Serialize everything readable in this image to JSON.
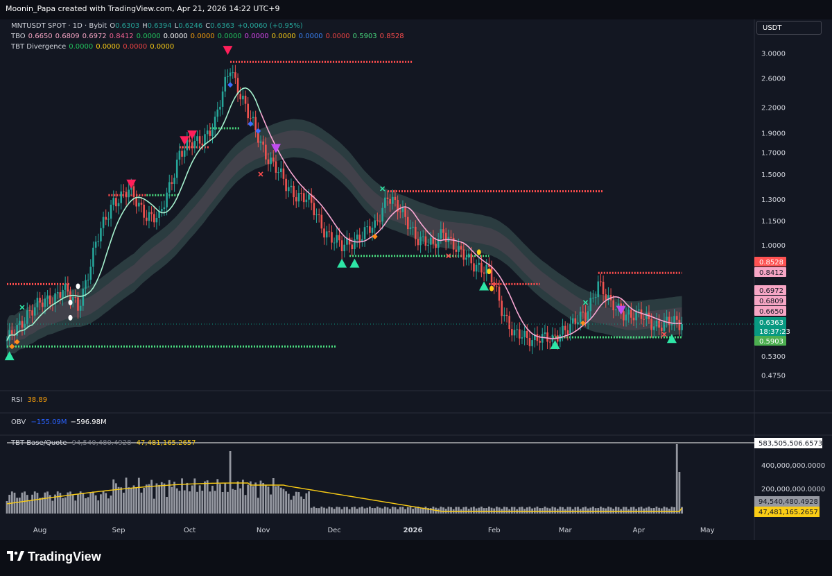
{
  "header": {
    "watermark": "Moonin_Papa created with TradingView.com, Apr 21, 2026 14:22 UTC+9",
    "currency_button": "USDT"
  },
  "legend": {
    "symbol_line": [
      {
        "text": "MNTUSDT SPOT · 1D · Bybit",
        "color": "#d1d4dc"
      },
      {
        "text": "O",
        "color": "#d1d4dc"
      },
      {
        "text": "0.6303",
        "color": "#26a69a"
      },
      {
        "text": "H",
        "color": "#d1d4dc"
      },
      {
        "text": "0.6394",
        "color": "#26a69a"
      },
      {
        "text": "L",
        "color": "#d1d4dc"
      },
      {
        "text": "0.6246",
        "color": "#26a69a"
      },
      {
        "text": "C",
        "color": "#d1d4dc"
      },
      {
        "text": "0.6363",
        "color": "#26a69a"
      },
      {
        "text": "+0.0060 (+0.95%)",
        "color": "#26a69a"
      }
    ],
    "tbo_line": [
      {
        "text": "TBO",
        "color": "#d1d4dc"
      },
      {
        "text": "0.6650",
        "color": "#f7a6c5"
      },
      {
        "text": "0.6809",
        "color": "#f7a6c5"
      },
      {
        "text": "0.6972",
        "color": "#f7a6c5"
      },
      {
        "text": "0.8412",
        "color": "#f06292"
      },
      {
        "text": "0.0000",
        "color": "#22c55e"
      },
      {
        "text": "0.0000",
        "color": "#ffffff"
      },
      {
        "text": "0.0000",
        "color": "#f59e0b"
      },
      {
        "text": "0.0000",
        "color": "#22c55e"
      },
      {
        "text": "0.0000",
        "color": "#d946ef"
      },
      {
        "text": "0.0000",
        "color": "#facc15"
      },
      {
        "text": "0.0000",
        "color": "#3b82f6"
      },
      {
        "text": "0.0000",
        "color": "#ef4444"
      },
      {
        "text": "0.5903",
        "color": "#4ade80"
      },
      {
        "text": "0.8528",
        "color": "#ff4d4d"
      }
    ],
    "divergence_line": [
      {
        "text": "TBT Divergence",
        "color": "#d1d4dc"
      },
      {
        "text": "0.0000",
        "color": "#22c55e"
      },
      {
        "text": "0.0000",
        "color": "#facc15"
      },
      {
        "text": "0.0000",
        "color": "#ef4444"
      },
      {
        "text": "0.0000",
        "color": "#facc15"
      }
    ]
  },
  "panes": {
    "rsi": {
      "name": "RSI",
      "value": "38.89",
      "value_color": "#f59e0b"
    },
    "obv": {
      "name": "OBV",
      "value1": "−155.09M",
      "value1_color": "#2962ff",
      "value2": "−596.98M",
      "value2_color": "#ffffff"
    },
    "volume": {
      "name": "TBT Base/Quote",
      "value1": "94,540,480.4928",
      "value2": "47,481,165.2657",
      "value2_color": "#facc15"
    }
  },
  "footer": {
    "brand": "TradingView"
  },
  "chart_data": {
    "type": "candlestick",
    "scale": "log",
    "price_axis_ticks": [
      "3.0000",
      "2.6000",
      "2.2000",
      "1.9000",
      "1.7000",
      "1.5000",
      "1.3000",
      "1.1500",
      "1.0000",
      "0.5300",
      "0.4750"
    ],
    "time_axis_ticks": [
      "Aug",
      "Sep",
      "Oct",
      "Nov",
      "Dec",
      "2026",
      "Feb",
      "Mar",
      "Apr",
      "May"
    ],
    "price_labels": [
      {
        "text": "0.8528",
        "bg": "#ff5252",
        "fg": "#ffffff",
        "value": 0.8528
      },
      {
        "text": "0.8412",
        "bg": "#f7a6c5",
        "fg": "#131722",
        "value": 0.8412
      },
      {
        "text": "0.6972",
        "bg": "#f7a6c5",
        "fg": "#131722",
        "value": 0.6972
      },
      {
        "text": "0.6809",
        "bg": "#f7a6c5",
        "fg": "#131722",
        "value": 0.6809
      },
      {
        "text": "0.6650",
        "bg": "#f7a6c5",
        "fg": "#131722",
        "value": 0.665
      },
      {
        "text": "0.6363",
        "bg": "#089981",
        "fg": "#ffffff",
        "value": 0.6363
      },
      {
        "text": "18:37:23",
        "bg": "#089981",
        "fg": "#ffffff",
        "value": 0.6363
      },
      {
        "text": "0.5903",
        "bg": "#4caf50",
        "fg": "#ffffff",
        "value": 0.5903
      }
    ],
    "close_anchors": [
      [
        0,
        0.57
      ],
      [
        8,
        0.68
      ],
      [
        15,
        0.72
      ],
      [
        22,
        0.78
      ],
      [
        28,
        0.7
      ],
      [
        35,
        1.0
      ],
      [
        42,
        1.3
      ],
      [
        48,
        1.35
      ],
      [
        55,
        1.2
      ],
      [
        60,
        1.15
      ],
      [
        68,
        1.7
      ],
      [
        75,
        1.8
      ],
      [
        82,
        2.0
      ],
      [
        88,
        2.8
      ],
      [
        95,
        2.1
      ],
      [
        102,
        1.7
      ],
      [
        110,
        1.4
      ],
      [
        118,
        1.3
      ],
      [
        125,
        1.1
      ],
      [
        132,
        0.98
      ],
      [
        138,
        1.05
      ],
      [
        145,
        1.1
      ],
      [
        150,
        1.35
      ],
      [
        155,
        1.2
      ],
      [
        162,
        1.05
      ],
      [
        168,
        0.98
      ],
      [
        172,
        1.1
      ],
      [
        178,
        0.95
      ],
      [
        185,
        0.9
      ],
      [
        190,
        0.85
      ],
      [
        195,
        0.7
      ],
      [
        200,
        0.6
      ],
      [
        205,
        0.58
      ],
      [
        210,
        0.6
      ],
      [
        215,
        0.57
      ],
      [
        220,
        0.63
      ],
      [
        228,
        0.66
      ],
      [
        233,
        0.82
      ],
      [
        238,
        0.7
      ],
      [
        245,
        0.68
      ],
      [
        255,
        0.64
      ],
      [
        266,
        0.6363
      ]
    ],
    "volume_ticks": [
      "583,505,506.6573",
      "400,000,000.0000",
      "200,000,000.0000"
    ],
    "volume_last": [
      {
        "text": "94,540,480.4928",
        "bg": "#9598a1"
      },
      {
        "text": "47,481,165.2657",
        "bg": "#facc15"
      }
    ],
    "horizontal_levels": [
      {
        "color": "#ff4d4d",
        "value": 2.85,
        "from": 88,
        "to": 160
      },
      {
        "color": "#ff4d4d",
        "value": 1.36,
        "from": 150,
        "to": 235
      },
      {
        "color": "#ff4d4d",
        "value": 0.8528,
        "from": 233,
        "to": 266
      },
      {
        "color": "#ff4d4d",
        "value": 0.8,
        "from": 0,
        "to": 25
      },
      {
        "color": "#ff4d4d",
        "value": 0.8,
        "from": 190,
        "to": 210
      },
      {
        "color": "#ff4d4d",
        "value": 1.33,
        "from": 40,
        "to": 55
      },
      {
        "color": "#ff4d4d",
        "value": 1.75,
        "from": 68,
        "to": 80
      },
      {
        "color": "#4ade80",
        "value": 0.56,
        "from": 0,
        "to": 130
      },
      {
        "color": "#4ade80",
        "value": 0.5903,
        "from": 215,
        "to": 266
      },
      {
        "color": "#4ade80",
        "value": 0.94,
        "from": 135,
        "to": 190
      },
      {
        "color": "#4ade80",
        "value": 1.33,
        "from": 55,
        "to": 68
      },
      {
        "color": "#4ade80",
        "value": 1.95,
        "from": 80,
        "to": 92
      }
    ],
    "markers": [
      {
        "kind": "tri-down",
        "color": "#ff1f5a",
        "day": 49,
        "value": 1.42
      },
      {
        "kind": "tri-down",
        "color": "#ff1f5a",
        "day": 70,
        "value": 1.82
      },
      {
        "kind": "tri-down",
        "color": "#ff1f5a",
        "day": 73,
        "value": 1.88
      },
      {
        "kind": "tri-down",
        "color": "#ff1f5a",
        "day": 87,
        "value": 3.05
      },
      {
        "kind": "tri-up",
        "color": "#2ee6a6",
        "day": 1,
        "value": 0.53
      },
      {
        "kind": "tri-up",
        "color": "#2ee6a6",
        "day": 132,
        "value": 0.9
      },
      {
        "kind": "tri-up",
        "color": "#2ee6a6",
        "day": 137,
        "value": 0.9
      },
      {
        "kind": "tri-up",
        "color": "#2ee6a6",
        "day": 188,
        "value": 0.79
      },
      {
        "kind": "tri-up",
        "color": "#2ee6a6",
        "day": 216,
        "value": 0.565
      },
      {
        "kind": "tri-up",
        "color": "#2ee6a6",
        "day": 262,
        "value": 0.585
      },
      {
        "kind": "diamond",
        "color": "#3b6cff",
        "day": 88,
        "value": 2.5
      },
      {
        "kind": "diamond",
        "color": "#3b6cff",
        "day": 96,
        "value": 2.0
      },
      {
        "kind": "diamond",
        "color": "#3b6cff",
        "day": 99,
        "value": 1.92
      },
      {
        "kind": "diamond",
        "color": "#ff8c1a",
        "day": 2,
        "value": 0.56
      },
      {
        "kind": "diamond",
        "color": "#ff8c1a",
        "day": 4,
        "value": 0.575
      },
      {
        "kind": "diamond",
        "color": "#ff8c1a",
        "day": 145,
        "value": 1.05
      },
      {
        "kind": "diamond",
        "color": "#ff8c1a",
        "day": 227,
        "value": 0.64
      },
      {
        "kind": "tri-down",
        "color": "#c04cf0",
        "day": 106,
        "value": 1.74
      },
      {
        "kind": "tri-down",
        "color": "#c04cf0",
        "day": 242,
        "value": 0.69
      },
      {
        "kind": "dot",
        "color": "#ffffff",
        "day": 28,
        "value": 0.79
      },
      {
        "kind": "dot",
        "color": "#ffffff",
        "day": 25,
        "value": 0.66
      },
      {
        "kind": "dot",
        "color": "#ffffff",
        "day": 25,
        "value": 0.72
      },
      {
        "kind": "dot",
        "color": "#facc15",
        "day": 186,
        "value": 0.96
      },
      {
        "kind": "dot",
        "color": "#facc15",
        "day": 190,
        "value": 0.86
      },
      {
        "kind": "dot",
        "color": "#facc15",
        "day": 191,
        "value": 0.78
      },
      {
        "kind": "x",
        "color": "#2ee6a6",
        "day": 6,
        "value": 0.7
      },
      {
        "kind": "x",
        "color": "#2ee6a6",
        "day": 148,
        "value": 1.38
      },
      {
        "kind": "x",
        "color": "#2ee6a6",
        "day": 228,
        "value": 0.72
      },
      {
        "kind": "x",
        "color": "#ff4d4d",
        "day": 100,
        "value": 1.5
      },
      {
        "kind": "x",
        "color": "#ff4d4d",
        "day": 174,
        "value": 0.94
      },
      {
        "kind": "x",
        "color": "#ff4d4d",
        "day": 259,
        "value": 0.6
      }
    ]
  }
}
